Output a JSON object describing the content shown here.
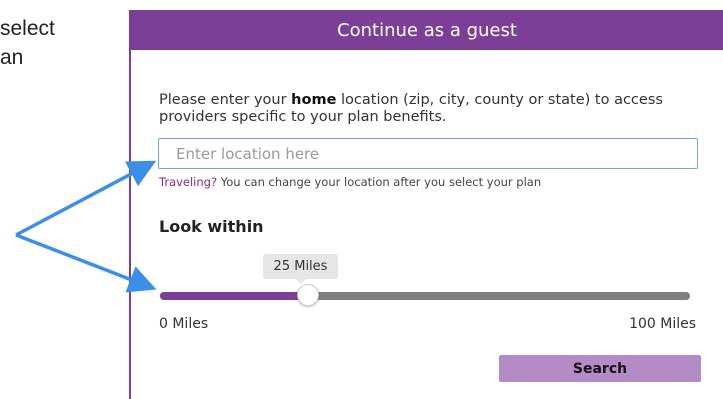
{
  "sidebar_text": {
    "line1": "select",
    "line2": "an"
  },
  "panel": {
    "header_title": "Continue as a guest",
    "instructions_before": "Please enter your ",
    "instructions_bold": "home",
    "instructions_after": " location (zip, city, county or state) to access providers specific to your plan benefits.",
    "location_placeholder": "Enter location here",
    "location_value": "",
    "travel_highlight": "Traveling?",
    "travel_note": " You can change your location after you select your plan",
    "look_within_label": "Look within",
    "slider": {
      "value_label": "25 Miles",
      "min_label": "0 Miles",
      "max_label": "100 Miles",
      "value_fraction": 0.28
    },
    "search_button_label": "Search"
  },
  "colors": {
    "brand_purple": "#7b3f98",
    "button_purple": "#b48bc6",
    "arrow_blue": "#3b8fe8",
    "input_border": "#6fa8dc"
  }
}
